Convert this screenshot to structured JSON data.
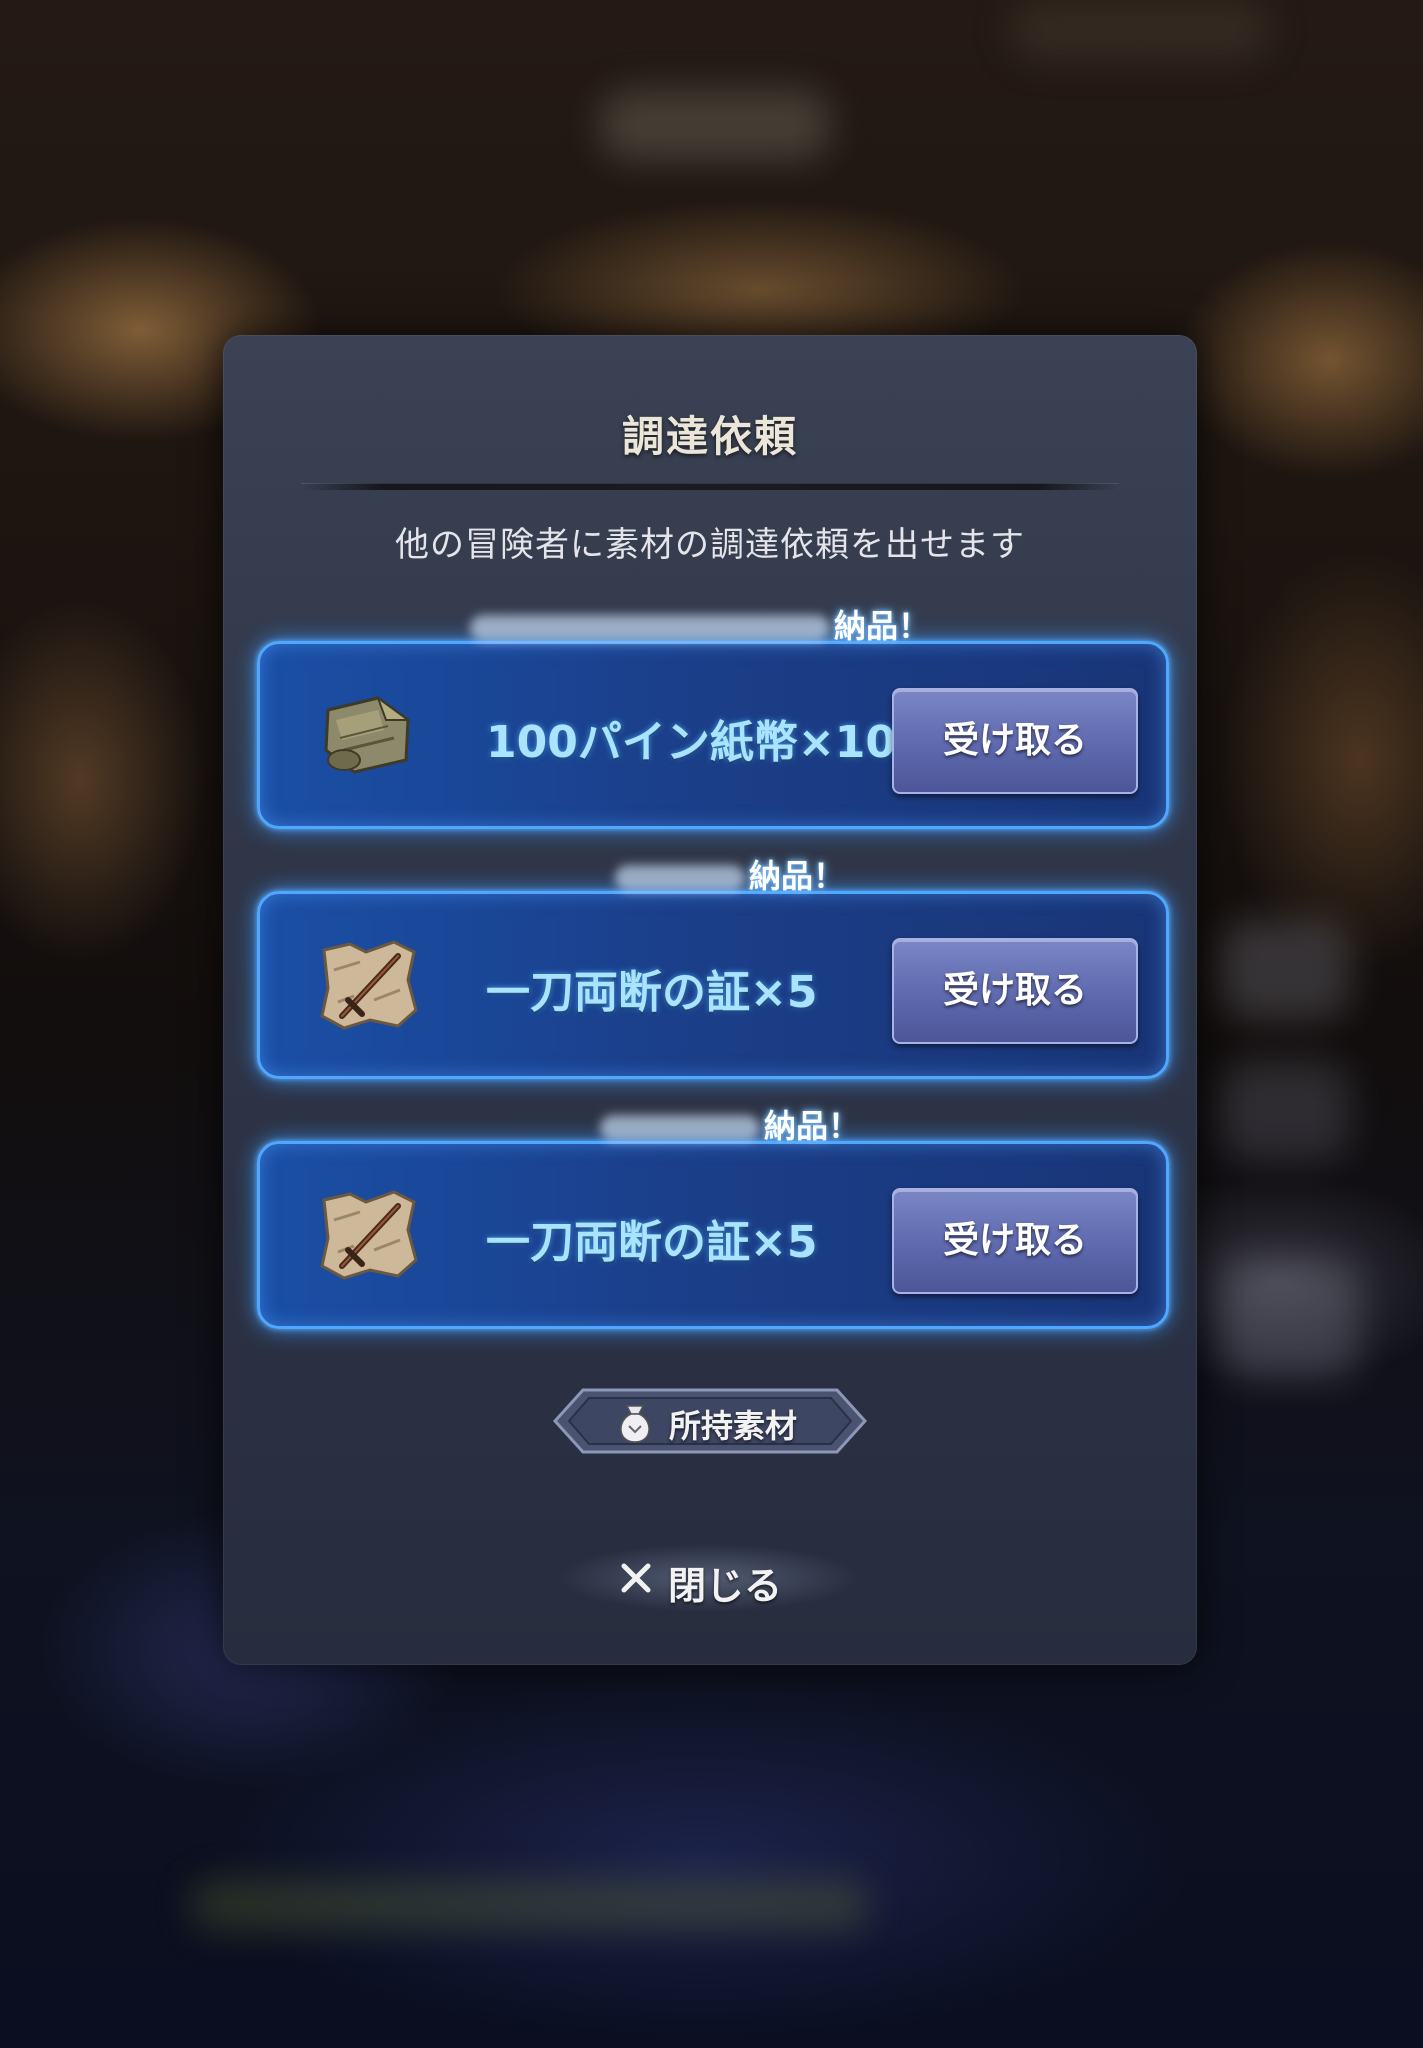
{
  "dialog": {
    "title": "調達依頼",
    "subtitle": "他の冒険者に素材の調達依頼を出せます"
  },
  "requests": [
    {
      "tag_suffix": "納品！",
      "item_name": "100パイン紙幣×10",
      "item_icon": "banknote-roll-icon",
      "button_label": "受け取る"
    },
    {
      "tag_suffix": "納品！",
      "item_name": "一刀両断の証×5",
      "item_icon": "sword-map-icon",
      "button_label": "受け取る"
    },
    {
      "tag_suffix": "納品！",
      "item_name": "一刀両断の証×5",
      "item_icon": "sword-map-icon",
      "button_label": "受け取る"
    }
  ],
  "materials_button": {
    "label": "所持素材",
    "icon": "bag-icon"
  },
  "close_button": {
    "label": "閉じる",
    "icon": "close-icon"
  },
  "colors": {
    "card_border": "#4fa8ff",
    "item_text": "#a9e3ff",
    "button_fill": "#5e69ae",
    "panel": "#2f3648"
  }
}
